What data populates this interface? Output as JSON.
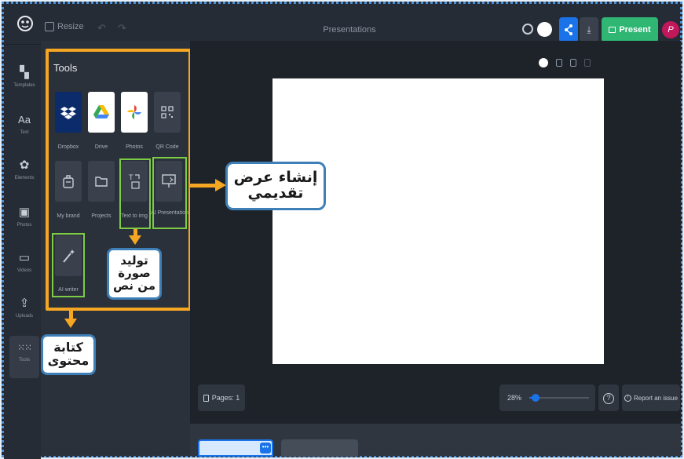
{
  "header": {
    "resize_label": "Resize",
    "title": "Presentations",
    "present_label": "Present",
    "avatar_initial": "P"
  },
  "rail": {
    "items": [
      {
        "label": "Templates",
        "icon": "templates-icon"
      },
      {
        "label": "Text",
        "icon": "text-icon"
      },
      {
        "label": "Elements",
        "icon": "elements-icon"
      },
      {
        "label": "Photos",
        "icon": "photos-icon"
      },
      {
        "label": "Videos",
        "icon": "videos-icon"
      },
      {
        "label": "Uploads",
        "icon": "uploads-icon"
      },
      {
        "label": "Tools",
        "icon": "tools-grid-icon"
      }
    ]
  },
  "panel": {
    "title": "Tools",
    "tools": [
      {
        "label": "Dropbox",
        "icon": "dropbox-icon"
      },
      {
        "label": "Drive",
        "icon": "google-drive-icon"
      },
      {
        "label": "Photos",
        "icon": "google-photos-icon"
      },
      {
        "label": "QR Code",
        "icon": "qr-code-icon"
      },
      {
        "label": "My brand",
        "icon": "brand-icon"
      },
      {
        "label": "Projects",
        "icon": "folder-icon"
      },
      {
        "label": "Text to img",
        "icon": "text-to-image-icon"
      },
      {
        "label": "AI Presentation",
        "icon": "ai-presentation-icon"
      },
      {
        "label": "AI writer",
        "icon": "magic-wand-icon"
      }
    ]
  },
  "canvas": {
    "pages_label": "Pages: 1",
    "zoom_label": "28%",
    "zoom_fraction": 0.1,
    "report_label": "Report an issue"
  },
  "callouts": {
    "presentation": "إنشاء عرض تقديمي",
    "text_to_image": "توليد صورة من نص",
    "writer": "كتابة محتوى"
  },
  "colors": {
    "highlight_orange": "#f5a623",
    "highlight_green": "#7ccc45",
    "present_green": "#2fb673",
    "share_blue": "#1a73e8"
  }
}
